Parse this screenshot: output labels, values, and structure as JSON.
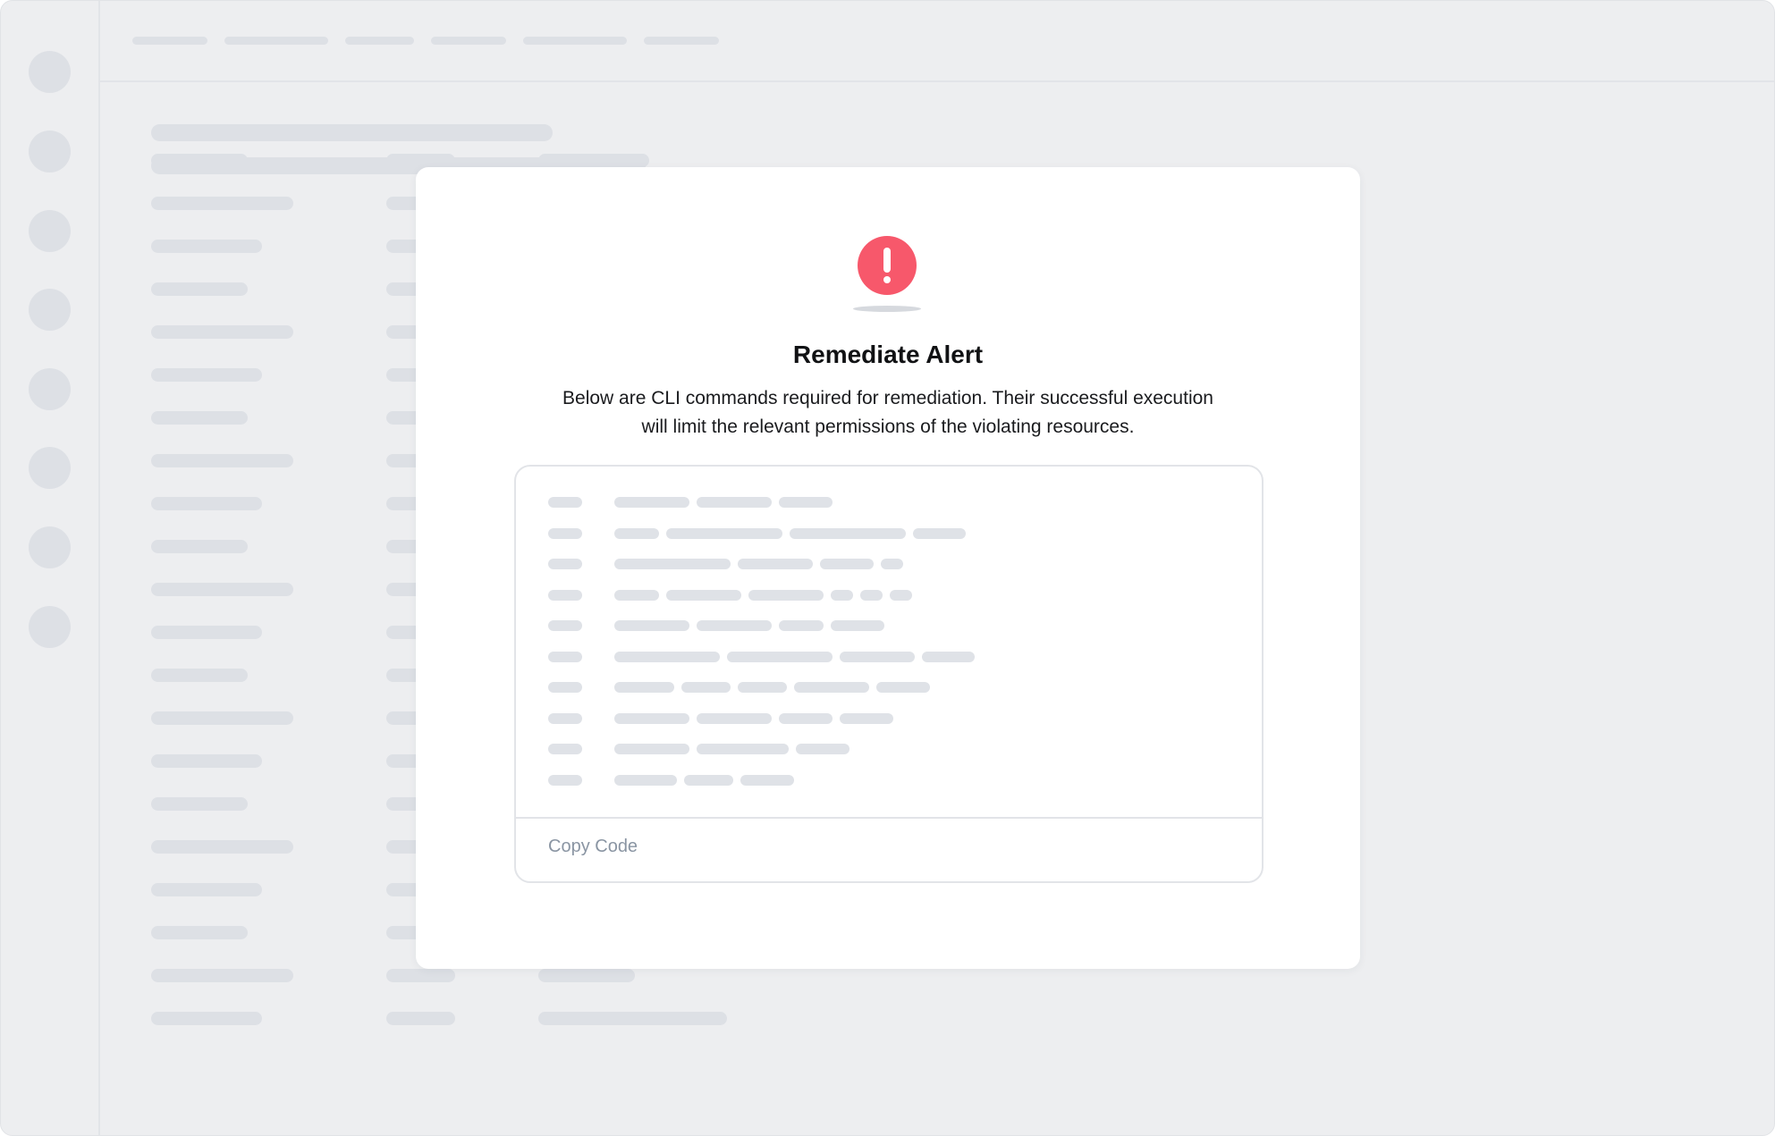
{
  "modal": {
    "title": "Remediate Alert",
    "description": "Below are CLI commands required for remediation. Their successful execution will limit the relevant permissions of the violating resources.",
    "icon": "alert-exclamation-icon",
    "copy_label": "Copy Code"
  },
  "colors": {
    "alert": "#f7586b",
    "background": "#edeef0",
    "modal": "#ffffff",
    "placeholder": "#dde0e5",
    "copy_text": "#8a95a3"
  }
}
